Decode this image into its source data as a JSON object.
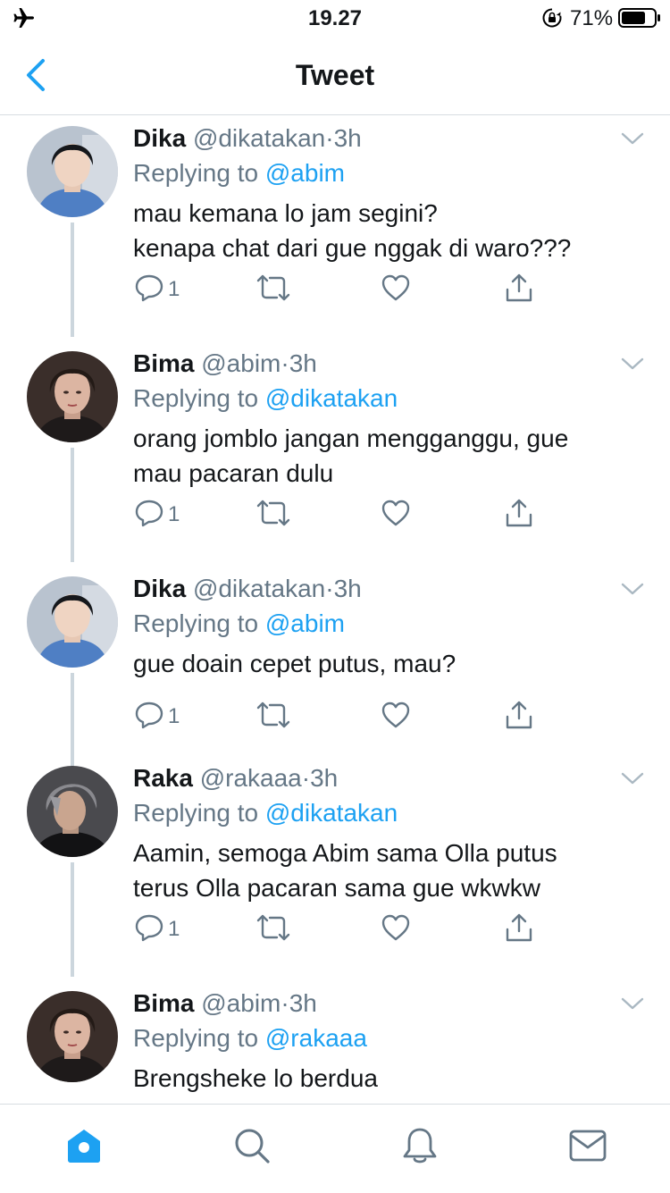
{
  "status_bar": {
    "time": "19.27",
    "battery_percent": "71%"
  },
  "nav": {
    "title": "Tweet"
  },
  "tweets": [
    {
      "name": "Dika",
      "handle": "@dikatakan",
      "dot": "·",
      "time": "3h",
      "replying_prefix": "Replying to",
      "replying_to": "@abim",
      "lines": [
        "mau kemana lo jam segini?",
        "kenapa chat dari gue nggak di waro???"
      ],
      "reply_count": "1"
    },
    {
      "name": "Bima",
      "handle": "@abim",
      "dot": "·",
      "time": "3h",
      "replying_prefix": "Replying to",
      "replying_to": "@dikatakan",
      "lines": [
        "orang jomblo jangan mengganggu, gue",
        "mau pacaran dulu"
      ],
      "reply_count": "1"
    },
    {
      "name": "Dika",
      "handle": "@dikatakan",
      "dot": "·",
      "time": "3h",
      "replying_prefix": "Replying to",
      "replying_to": "@abim",
      "lines": [
        "gue doain cepet putus, mau?",
        ""
      ],
      "reply_count": "1"
    },
    {
      "name": "Raka",
      "handle": "@rakaaa",
      "dot": "·",
      "time": "3h",
      "replying_prefix": "Replying to",
      "replying_to": "@dikatakan",
      "lines": [
        "Aamin, semoga Abim sama Olla putus",
        "terus Olla pacaran sama gue wkwkw"
      ],
      "reply_count": "1"
    },
    {
      "name": "Bima",
      "handle": "@abim",
      "dot": "·",
      "time": "3h",
      "replying_prefix": "Replying to",
      "replying_to": "@rakaaa",
      "lines": [
        "Brengsheke lo berdua",
        ""
      ],
      "reply_count": ""
    }
  ],
  "icons": {
    "status": [
      "airplane-icon",
      "orientation-lock-icon",
      "battery-icon"
    ],
    "nav": [
      "back-chevron-icon"
    ],
    "tweet_actions": [
      "reply-icon",
      "retweet-icon",
      "like-icon",
      "share-icon"
    ],
    "tabs": [
      "home-icon",
      "search-icon",
      "notifications-icon",
      "messages-icon"
    ]
  },
  "colors": {
    "accent": "#1da1f2",
    "secondary_text": "#657786",
    "primary_text": "#14171a",
    "divider": "#d8dde1",
    "thread_line": "#ccd6dd"
  }
}
